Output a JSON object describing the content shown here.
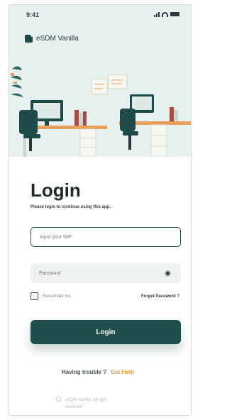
{
  "status_bar": {
    "time": "9:41"
  },
  "app": {
    "name": "eSDM Vanilla"
  },
  "login": {
    "title": "Login",
    "subtitle": "Please login to continue using this app.",
    "nip_placeholder": "Input your NIP",
    "password_placeholder": "Password",
    "remember_label": "Remember me",
    "forget_label": "Forget Password ?",
    "button_label": "Login"
  },
  "help": {
    "text": "Having trouble ?",
    "link": "Get Help"
  },
  "footer": {
    "line1": "eSDM Vanilla. all right",
    "line2": "reserved."
  },
  "colors": {
    "primary": "#1f4f4b",
    "accent": "#f29b2f",
    "hero_bg": "#e7f1ef"
  }
}
